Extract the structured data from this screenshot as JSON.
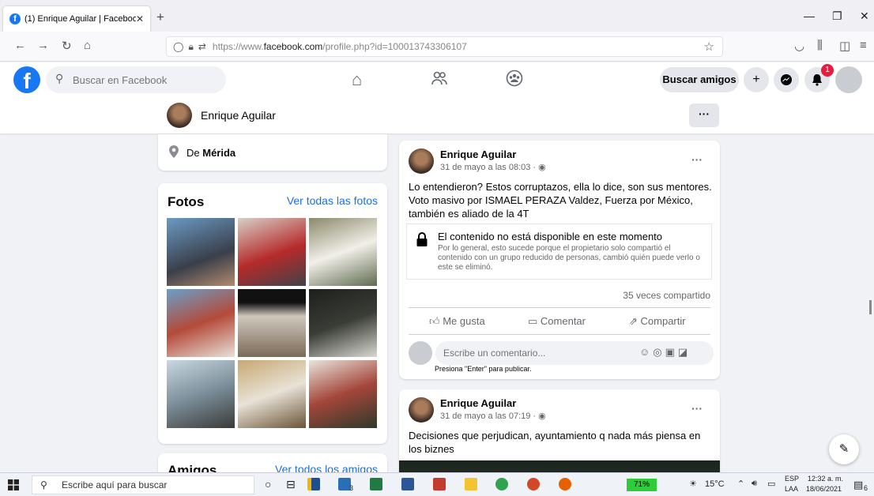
{
  "browser": {
    "tab_title": "(1) Enrique Aguilar | Facebook",
    "new_tab": "+",
    "url_prefix": "https://www.",
    "url_domain": "facebook.com",
    "url_path": "/profile.php?id=100013743306107"
  },
  "header": {
    "search_placeholder": "Buscar en Facebook",
    "find_friends_label": "Buscar amigos",
    "notification_count": "1"
  },
  "profile": {
    "name": "Enrique Aguilar",
    "more_label": "···"
  },
  "intro": {
    "location_prefix": "De ",
    "location_city": "Mérida"
  },
  "photos": {
    "title": "Fotos",
    "see_all": "Ver todas las fotos",
    "items": [
      "photo-1",
      "photo-2",
      "photo-3",
      "photo-4",
      "photo-5",
      "photo-6",
      "photo-7",
      "photo-8",
      "photo-9"
    ]
  },
  "friends": {
    "title": "Amigos",
    "see_all": "Ver todos los amigos"
  },
  "posts": [
    {
      "author": "Enrique Aguilar",
      "date": "31 de mayo a las 08:03 · ",
      "text": "Lo entendieron? Estos corruptazos, ella lo dice, son sus mentores. Voto masivo por ISMAEL PERAZA Valdez, Fuerza por México, también es aliado de la 4T",
      "unavailable_title": "El contenido no está disponible en este momento",
      "unavailable_desc": "Por lo general, esto sucede porque el propietario solo compartió el contenido con un grupo reducido de personas, cambió quién puede verlo o este se eliminó.",
      "shares": "35 veces compartido",
      "like_label": "Me gusta",
      "comment_label": "Comentar",
      "share_label": "Compartir",
      "comment_placeholder": "Escribe un comentario...",
      "enter_hint": "Presiona \"Enter\" para publicar."
    },
    {
      "author": "Enrique Aguilar",
      "date": "31 de mayo a las 07:19 · ",
      "text": "Decisiones que perjudican, ayuntamiento q nada más piensa en los biznes"
    }
  ],
  "taskbar": {
    "search_placeholder": "Escribe aquí para buscar",
    "battery": "71%",
    "temperature": "15°C",
    "language": "ESP",
    "layout": "LAA",
    "time": "12:32 a. m.",
    "date": "18/06/2021",
    "notif_count": "6",
    "mail_badge": "3"
  }
}
